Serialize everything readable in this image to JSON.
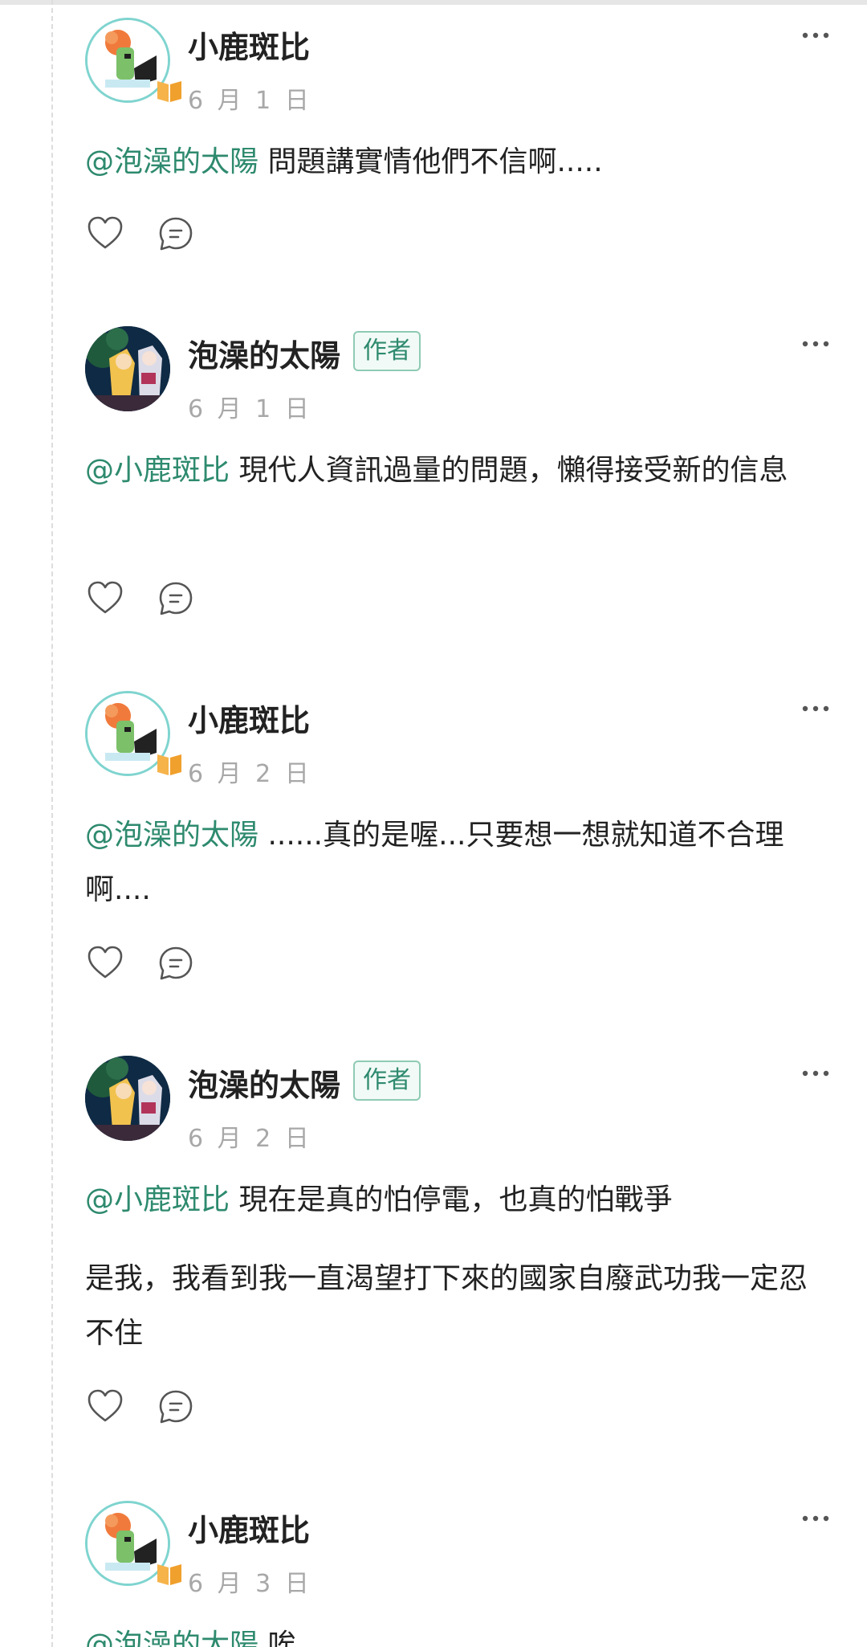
{
  "icons": {
    "more": "more-horizontal-icon",
    "like": "heart-outline-icon",
    "reply": "comment-bubble-icon",
    "badge": "book-badge-icon"
  },
  "colors": {
    "mention": "#2e8a6e",
    "author_tag_border": "#8fcab4",
    "date": "#a8a8a8"
  },
  "comments": [
    {
      "user": "小鹿斑比",
      "is_author": false,
      "date": "6 月 1 日",
      "paragraphs": [
        {
          "mention": "@泡澡的太陽",
          "text": " 問題講實情他們不信啊....."
        }
      ]
    },
    {
      "user": "泡澡的太陽",
      "is_author": true,
      "author_label": "作者",
      "date": "6 月 1 日",
      "paragraphs": [
        {
          "mention": "@小鹿斑比",
          "text": " 現代人資訊過量的問題，懶得接受新的信息"
        }
      ]
    },
    {
      "user": "小鹿斑比",
      "is_author": false,
      "date": "6 月 2 日",
      "paragraphs": [
        {
          "mention": "@泡澡的太陽",
          "text": " ......真的是喔...只要想一想就知道不合理啊...."
        }
      ]
    },
    {
      "user": "泡澡的太陽",
      "is_author": true,
      "author_label": "作者",
      "date": "6 月 2 日",
      "paragraphs": [
        {
          "mention": "@小鹿斑比",
          "text": " 現在是真的怕停電，也真的怕戰爭"
        },
        {
          "mention": "",
          "text": "是我，我看到我一直渴望打下來的國家自廢武功我一定忍不住"
        }
      ]
    },
    {
      "user": "小鹿斑比",
      "is_author": false,
      "date": "6 月 3 日",
      "paragraphs": [
        {
          "mention": "@泡澡的太陽",
          "text": " 唉"
        }
      ]
    }
  ]
}
